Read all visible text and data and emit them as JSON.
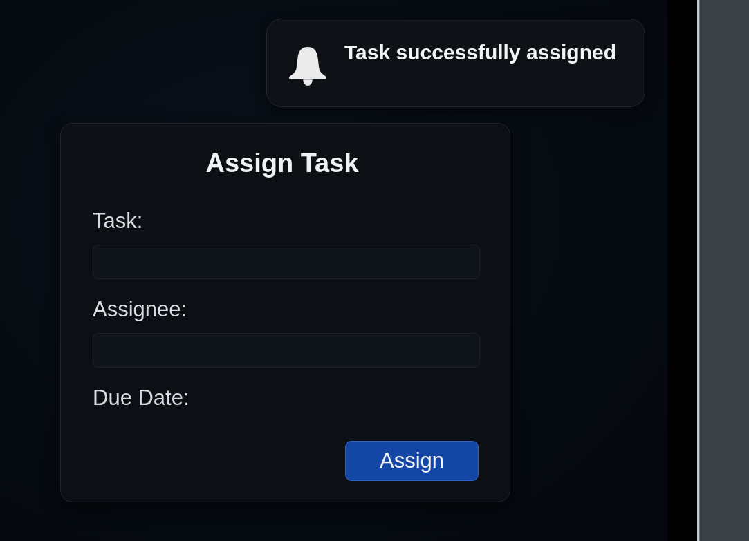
{
  "notification": {
    "message": "Task successfully assigned"
  },
  "form": {
    "title": "Assign Task",
    "fields": [
      {
        "kind": "input",
        "label": "Task:"
      },
      {
        "kind": "input",
        "label": "Assignee:"
      },
      {
        "kind": "label",
        "label": "Due Date:"
      }
    ],
    "submit": "Assign"
  }
}
